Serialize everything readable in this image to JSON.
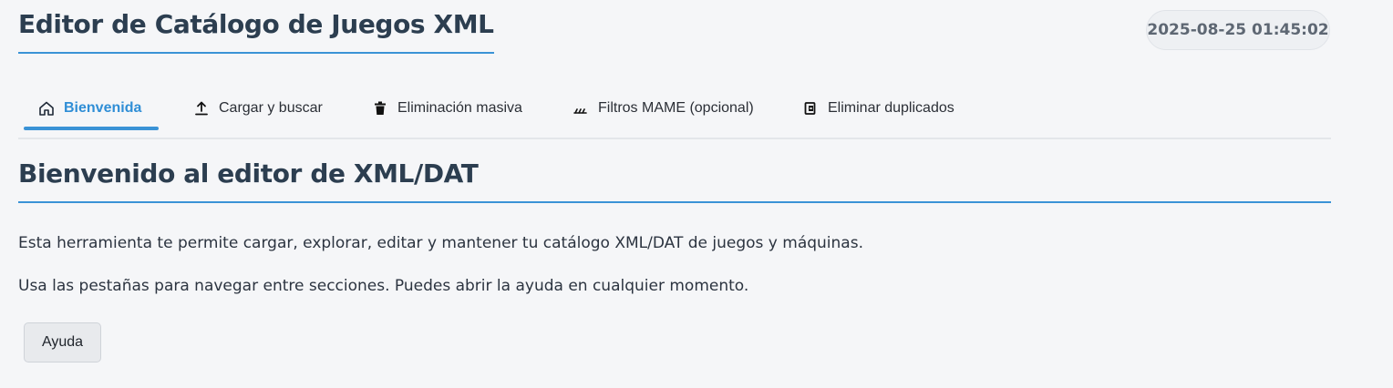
{
  "header": {
    "title": "Editor de Catálogo de Juegos XML",
    "datetime": "2025-08-25 01:45:02"
  },
  "tabs": [
    {
      "label": "Bienvenida",
      "icon": "home-icon",
      "active": true
    },
    {
      "label": "Cargar y buscar",
      "icon": "upload-icon",
      "active": false
    },
    {
      "label": "Eliminación masiva",
      "icon": "trash-icon",
      "active": false
    },
    {
      "label": "Filtros MAME (opcional)",
      "icon": "sliders-icon",
      "active": false
    },
    {
      "label": "Eliminar duplicados",
      "icon": "remove-duplicate-icon",
      "active": false
    }
  ],
  "main": {
    "section_title": "Bienvenido al editor de XML/DAT",
    "paragraph_1": "Esta herramienta te permite cargar, explorar, editar y mantener tu catálogo XML/DAT de juegos y máquinas.",
    "paragraph_2": "Usa las pestañas para navegar entre secciones. Puedes abrir la ayuda en cualquier momento.",
    "help_button_label": "Ayuda"
  },
  "colors": {
    "accent": "#3a93d6",
    "background": "#f5f6f8",
    "title_text": "#2c3e50"
  }
}
